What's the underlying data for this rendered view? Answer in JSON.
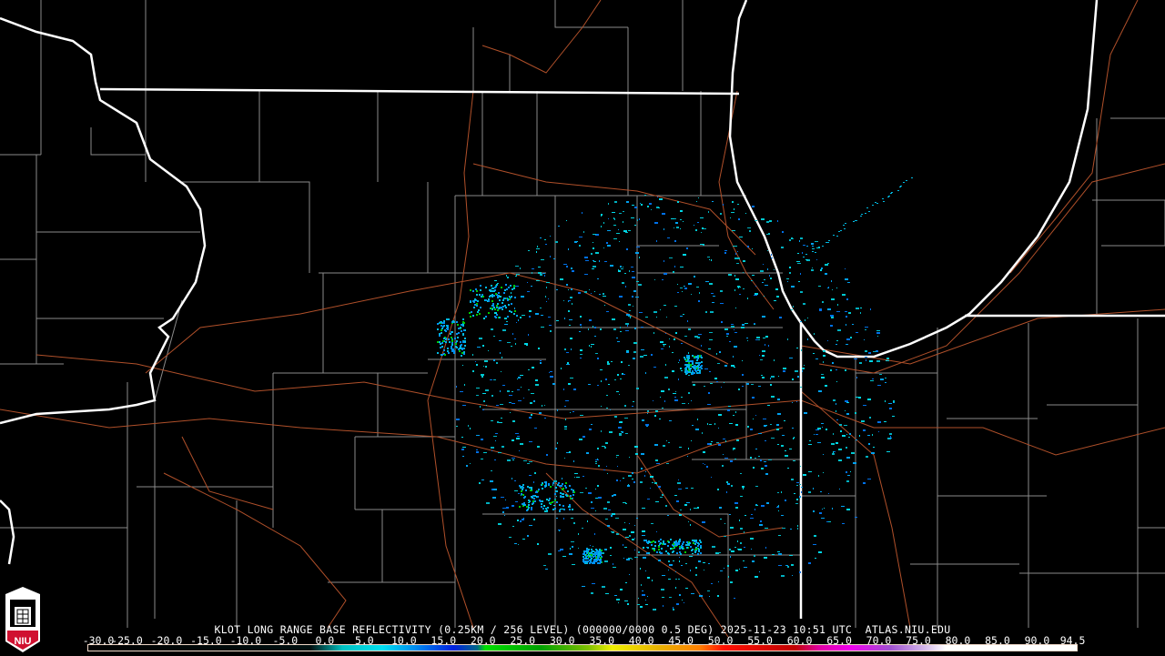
{
  "title": "KLOT LONG RANGE BASE REFLECTIVITY (0.25KM / 256 LEVEL) (000000/0000 0.5 DEG) 2025-11-23 10:51 UTC  ATLAS.NIU.EDU",
  "logo_text": "NIU",
  "colorbar": {
    "labels": [
      "-30.0",
      "-25.0",
      "-20.0",
      "-15.0",
      "-10.0",
      "-5.0",
      "0.0",
      "5.0",
      "10.0",
      "15.0",
      "20.0",
      "25.0",
      "30.0",
      "35.0",
      "40.0",
      "45.0",
      "50.0",
      "55.0",
      "60.0",
      "65.0",
      "70.0",
      "75.0",
      "80.0",
      "85.0",
      "90.0",
      "94.5"
    ],
    "stops": [
      {
        "dbz": -30,
        "color": "#000000"
      },
      {
        "dbz": -2,
        "color": "#001010"
      },
      {
        "dbz": 0,
        "color": "#006868"
      },
      {
        "dbz": 2,
        "color": "#00c0c0"
      },
      {
        "dbz": 7,
        "color": "#00e0f0"
      },
      {
        "dbz": 11,
        "color": "#0090f0"
      },
      {
        "dbz": 16,
        "color": "#0020e0"
      },
      {
        "dbz": 19,
        "color": "#006888"
      },
      {
        "dbz": 20,
        "color": "#00e000"
      },
      {
        "dbz": 27,
        "color": "#00a000"
      },
      {
        "dbz": 33,
        "color": "#80c000"
      },
      {
        "dbz": 36,
        "color": "#f0f000"
      },
      {
        "dbz": 42,
        "color": "#e8b000"
      },
      {
        "dbz": 47,
        "color": "#ff8000"
      },
      {
        "dbz": 50,
        "color": "#ff1000"
      },
      {
        "dbz": 59,
        "color": "#c00000"
      },
      {
        "dbz": 62,
        "color": "#e000a0"
      },
      {
        "dbz": 66,
        "color": "#f000f0"
      },
      {
        "dbz": 71,
        "color": "#a050d0"
      },
      {
        "dbz": 75,
        "color": "#d0b0e8"
      },
      {
        "dbz": 78,
        "color": "#ffffff"
      },
      {
        "dbz": 94.5,
        "color": "#ffffff"
      }
    ]
  },
  "colors": {
    "boundary": "#ffffff",
    "county": "#8a8a8a",
    "highway": "#b0502a",
    "logo_red": "#d01030"
  }
}
